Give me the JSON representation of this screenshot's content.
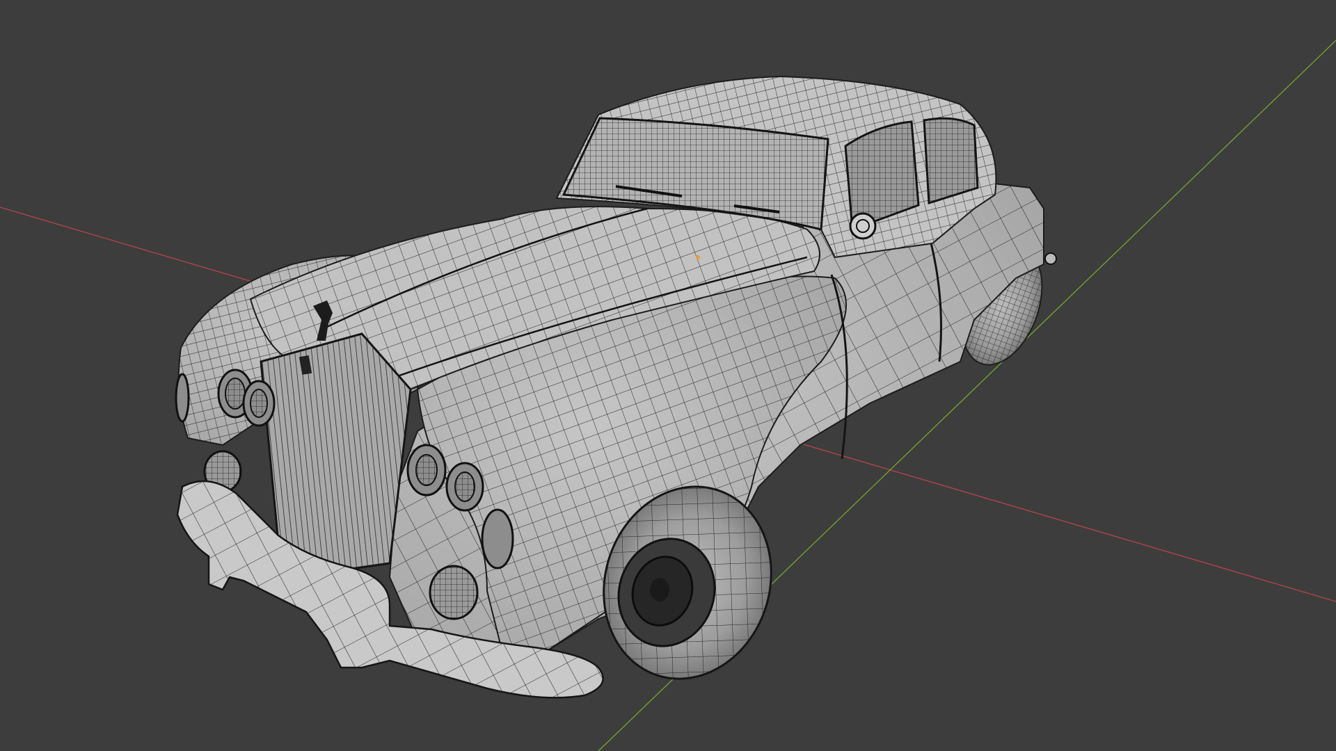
{
  "viewport": {
    "background": "#3d3d3d",
    "x_axis_color": "#b8434b",
    "y_axis_color": "#7aa32e",
    "object_origin_color": "#e8a13a",
    "mesh_surface_color": "#b9b9b9",
    "wire_color": "#1e1e1e",
    "object": "vintage-sedan-wireframe-mesh"
  }
}
